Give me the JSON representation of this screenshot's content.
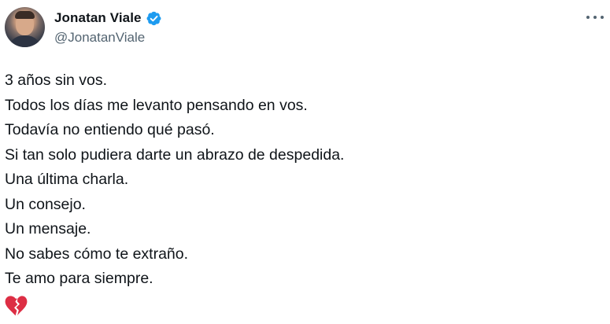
{
  "author": {
    "display_name": "Jonatan Viale",
    "handle": "@JonatanViale",
    "verified": true,
    "verified_color": "#1d9bf0"
  },
  "tweet": {
    "lines": [
      "3 años sin vos.",
      "Todos los días me levanto pensando en vos.",
      "Todavía no entiendo qué pasó.",
      "Si tan solo pudiera darte un abrazo de despedida.",
      "Una última charla.",
      "Un consejo.",
      "Un mensaje.",
      "No sabes cómo te extraño.",
      "Te amo para siempre."
    ],
    "emoji": "broken-heart-icon",
    "emoji_color": "#dd2e44"
  },
  "icons": {
    "more": "more-options-icon",
    "verified": "verified-badge-icon"
  }
}
